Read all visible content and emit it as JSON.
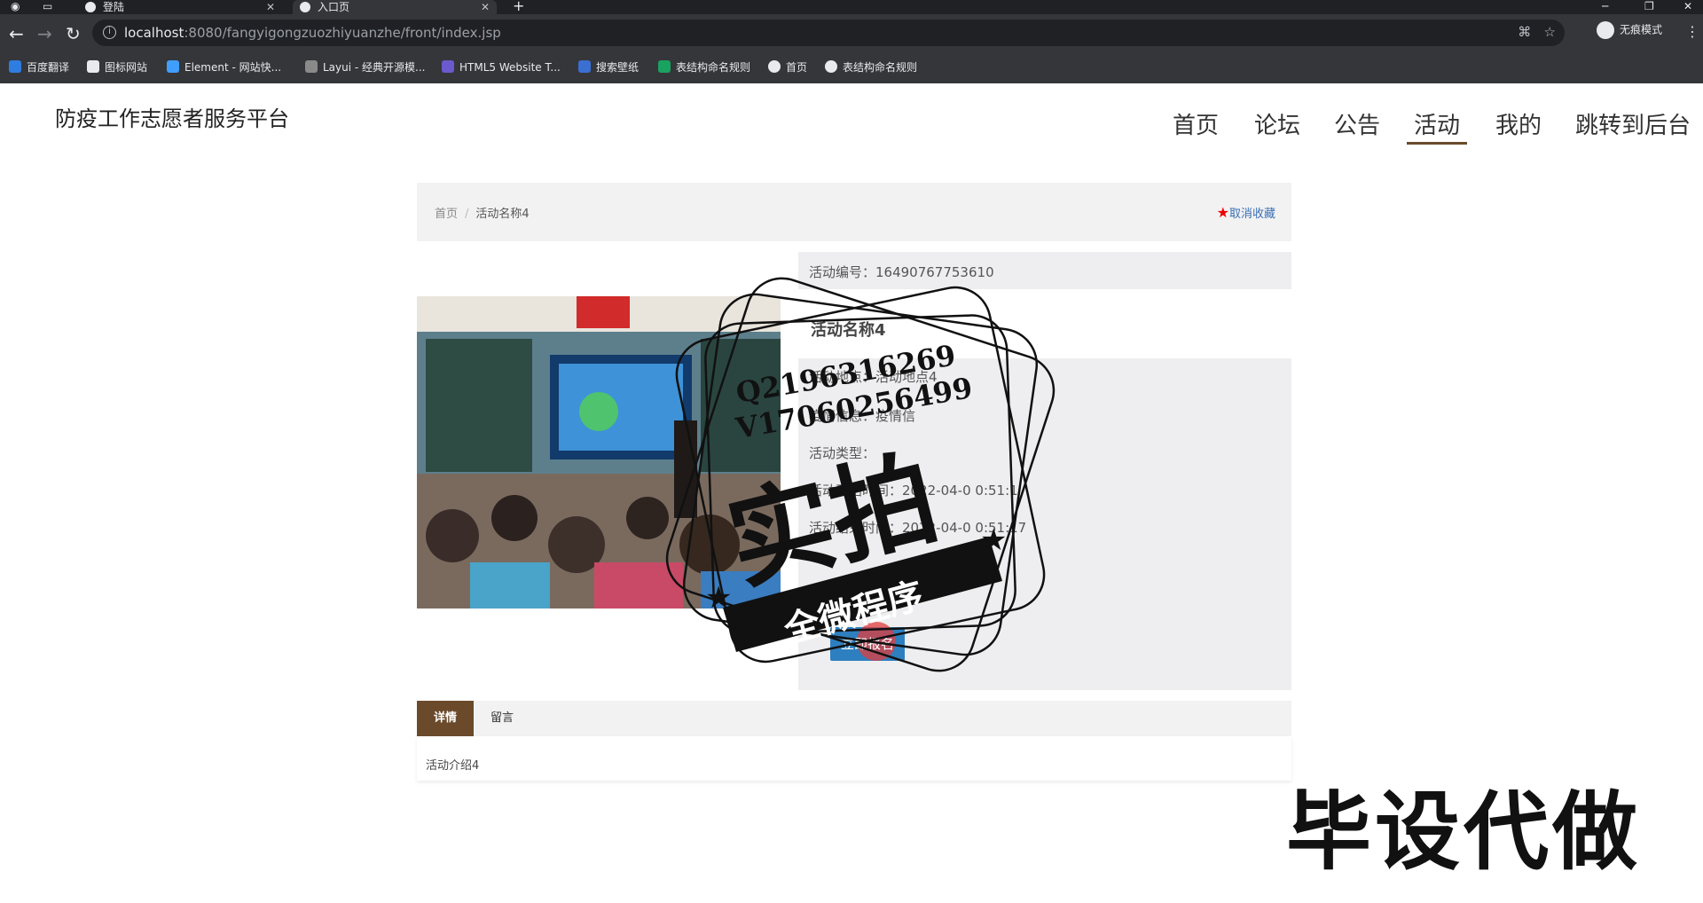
{
  "browser": {
    "tabs": [
      {
        "label": "登陆",
        "active": false
      },
      {
        "label": "入口页",
        "active": true
      }
    ],
    "new_tab": "+",
    "url_host": "localhost",
    "url_rest": ":8080/fangyigongzuozhiyuanzhe/front/index.jsp",
    "incognito_label": "无痕模式",
    "bookmarks": [
      "百度翻译",
      "图标网站",
      "Element - 网站快...",
      "Layui - 经典开源模...",
      "HTML5 Website T...",
      "搜索壁纸",
      "表结构命名规则",
      "首页",
      "表结构命名规则"
    ]
  },
  "site": {
    "title": "防疫工作志愿者服务平台",
    "nav": [
      "首页",
      "论坛",
      "公告",
      "活动",
      "我的",
      "跳转到后台"
    ],
    "active_nav": "活动"
  },
  "breadcrumb": {
    "home": "首页",
    "sep": "/",
    "current": "活动名称4"
  },
  "favorite": {
    "label": "取消收藏"
  },
  "activity": {
    "id_row": "活动编号：16490767753610",
    "name": "活动名称4",
    "rows": [
      "活动地点：活动地点4",
      "疫情信息：疫情信",
      "活动类型：",
      "活动开始时间：2022-04-0 0:51:1",
      "活动结束时间：2022-04-0 0:51:17"
    ],
    "join_button": "立即报名"
  },
  "detail_tabs": [
    "详情",
    "留言"
  ],
  "detail_content": "活动介绍4",
  "watermark": {
    "qq": "Q2196316269",
    "vx": "V17060256499",
    "big": "实拍",
    "ribbon": "全微程序",
    "corner": "毕设代做"
  },
  "colors": {
    "brand": "#6b4a2b",
    "button": "#2e7fbf",
    "star": "#e00000"
  }
}
